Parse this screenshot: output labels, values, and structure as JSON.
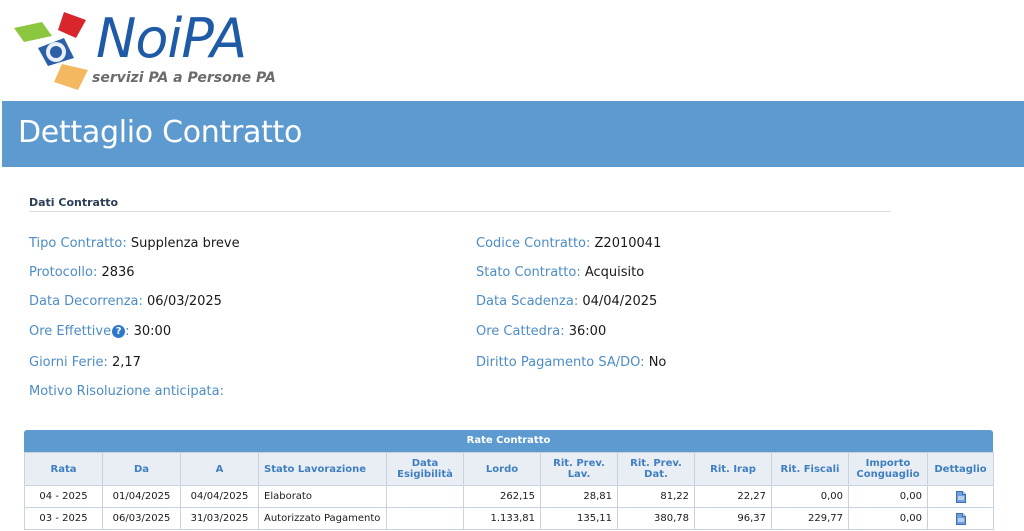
{
  "logo": {
    "wordmark": "NoiPA",
    "tagline": "servizi PA a Persone PA"
  },
  "header": {
    "title": "Dettaglio Contratto"
  },
  "section": {
    "title": "Dati Contratto",
    "fields": {
      "tipo_contratto": {
        "label": "Tipo Contratto:",
        "value": "Supplenza breve"
      },
      "protocollo": {
        "label": "Protocollo:",
        "value": "2836"
      },
      "data_decorrenza": {
        "label": "Data Decorrenza:",
        "value": "06/03/2025"
      },
      "ore_effettive": {
        "label": "Ore Effettive",
        "value": "30:00"
      },
      "giorni_ferie": {
        "label": "Giorni Ferie:",
        "value": "2,17"
      },
      "motivo_risoluzione": {
        "label": "Motivo Risoluzione anticipata:",
        "value": ""
      },
      "codice_contratto": {
        "label": "Codice Contratto:",
        "value": "Z2010041"
      },
      "stato_contratto": {
        "label": "Stato Contratto:",
        "value": "Acquisito"
      },
      "data_scadenza": {
        "label": "Data Scadenza:",
        "value": "04/04/2025"
      },
      "ore_cattedra": {
        "label": "Ore Cattedra:",
        "value": "36:00"
      },
      "diritto_pagamento": {
        "label": "Diritto Pagamento SA/DO:",
        "value": "No"
      }
    }
  },
  "rate_table": {
    "caption": "Rate Contratto",
    "columns": [
      "Rata",
      "Da",
      "A",
      "Stato Lavorazione",
      "Data Esigibilità",
      "Lordo",
      "Rit. Prev. Lav.",
      "Rit. Prev. Dat.",
      "Rit. Irap",
      "Rit. Fiscali",
      "Importo Conguaglio",
      "Dettaglio"
    ],
    "rows": [
      [
        "04 - 2025",
        "01/04/2025",
        "04/04/2025",
        "Elaborato",
        "",
        "262,15",
        "28,81",
        "81,22",
        "22,27",
        "0,00",
        "0,00"
      ],
      [
        "03 - 2025",
        "06/03/2025",
        "31/03/2025",
        "Autorizzato Pagamento",
        "",
        "1.133,81",
        "135,11",
        "380,78",
        "96,37",
        "229,77",
        "0,00"
      ]
    ]
  },
  "colors": {
    "accent": "#5c9ad0",
    "label": "#4d8cc4",
    "brand": "#1f5aa6"
  }
}
